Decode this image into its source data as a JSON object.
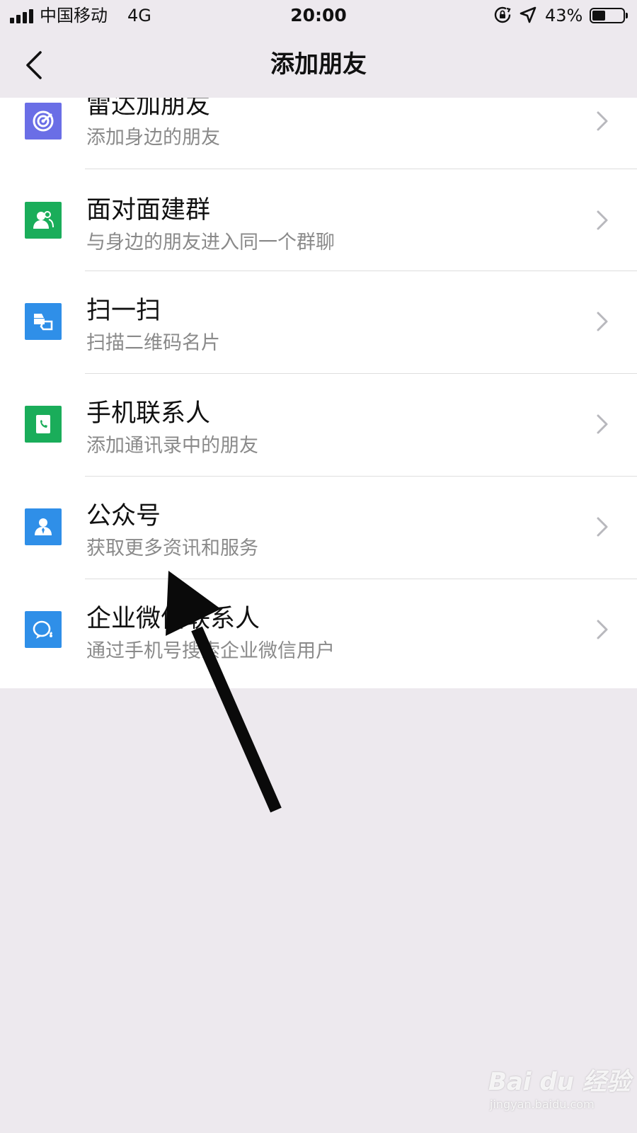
{
  "status_bar": {
    "carrier": "中国移动",
    "network": "4G",
    "time": "20:00",
    "battery_percent": "43%",
    "battery_level": 0.43,
    "icons": [
      "signal-icon",
      "orientation-lock-icon",
      "location-icon",
      "battery-icon"
    ]
  },
  "nav": {
    "title": "添加朋友",
    "back_icon": "chevron-left-icon"
  },
  "items": [
    {
      "title": "雷达加朋友",
      "subtitle": "添加身边的朋友",
      "icon": "radar-icon",
      "icon_color": "#6a6ee6"
    },
    {
      "title": "面对面建群",
      "subtitle": "与身边的朋友进入同一个群聊",
      "icon": "face-to-face-group-icon",
      "icon_color": "#1aad5a"
    },
    {
      "title": "扫一扫",
      "subtitle": "扫描二维码名片",
      "icon": "scan-icon",
      "icon_color": "#2f8fe8"
    },
    {
      "title": "手机联系人",
      "subtitle": "添加通讯录中的朋友",
      "icon": "phone-contacts-icon",
      "icon_color": "#1aad5a"
    },
    {
      "title": "公众号",
      "subtitle": "获取更多资讯和服务",
      "icon": "official-account-icon",
      "icon_color": "#2f8fe8"
    },
    {
      "title": "企业微信联系人",
      "subtitle": "通过手机号搜索企业微信用户",
      "icon": "wecom-contacts-icon",
      "icon_color": "#2f8fe8"
    }
  ],
  "watermark": {
    "logo": "Bai du 经验",
    "url": "jingyan.baidu.com"
  }
}
